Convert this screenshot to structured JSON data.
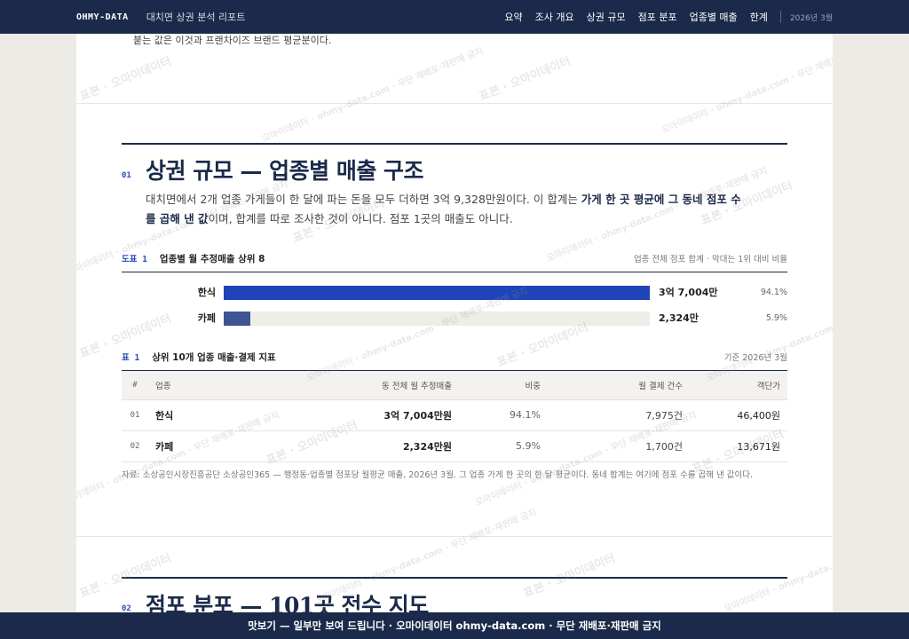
{
  "nav": {
    "brand": "OHMY-DATA",
    "report_title": "대치면 상권 분석 리포트",
    "links": [
      "요약",
      "조사 개요",
      "상권 규모",
      "점포 분포",
      "업종별 매출",
      "한계"
    ],
    "date": "2026년 3월"
  },
  "prev_section": {
    "tail_text": "붙는 값은 이것과 프랜차이즈 브랜드 평균분이다."
  },
  "section": {
    "number": "01",
    "title": "상권 규모 — 업종별 매출 구조",
    "lead_1": "대치면에서 2개 업종 가게들이 한 달에 파는 돈을 모두 더하면 3억 9,328만원이다. 이 합계는 ",
    "lead_bold": "가게 한 곳 평균에 그 동네 점포 수를 곱해 낸 값",
    "lead_2": "이며, 합계를 따로 조사한 것이 아니다. 점포 1곳의 매출도 아니다."
  },
  "figure": {
    "tag": "도표 1",
    "title": "업종별 월 추정매출 상위 8",
    "note": "업종 전체 점포 합계 · 막대는 1위 대비 비율"
  },
  "chart_data": {
    "type": "bar",
    "title": "업종별 월 추정매출 상위 8",
    "categories": [
      "한식",
      "카페"
    ],
    "values": [
      1.0,
      0.0624
    ],
    "value_labels": [
      "3억 7,004만",
      "2,324만"
    ],
    "share_labels": [
      "94.1%",
      "5.9%"
    ],
    "colors": [
      "#1f44b8",
      "#3d5590"
    ]
  },
  "table": {
    "tag": "표 1",
    "title": "상위 10개 업종 매출·결제 지표",
    "note": "기준 2026년 3월",
    "headers": [
      "#",
      "업종",
      "동 전체 월 추정매출",
      "비중",
      "월 결제 건수",
      "객단가"
    ],
    "rows": [
      {
        "idx": "01",
        "name": "한식",
        "sales": "3억 7,004만원",
        "share": "94.1%",
        "count": "7,975건",
        "avg": "46,400원"
      },
      {
        "idx": "02",
        "name": "카페",
        "sales": "2,324만원",
        "share": "5.9%",
        "count": "1,700건",
        "avg": "13,671원"
      }
    ]
  },
  "source": "자료: 소상공인시장진흥공단 소상공인365 — 행정동·업종별 점포당 월평균 매출, 2026년 3월. 그 업종 가게 한 곳의 한 달 평균이다. 동네 합계는 여기에 점포 수를 곱해 낸 값이다.",
  "next_section": {
    "number": "02",
    "title": "점포 분포 — 101곳 전수 지도"
  },
  "watermark": {
    "text": "표본 · 오마이데이터",
    "text_small": "오마이데이터 · ohmy-data.com · 무단 재배포·재판매 금지"
  },
  "footer": {
    "text": "맛보기 — 일부만 보여 드립니다 · 오마이데이터 ohmy-data.com · 무단 재배포·재판매 금지"
  }
}
